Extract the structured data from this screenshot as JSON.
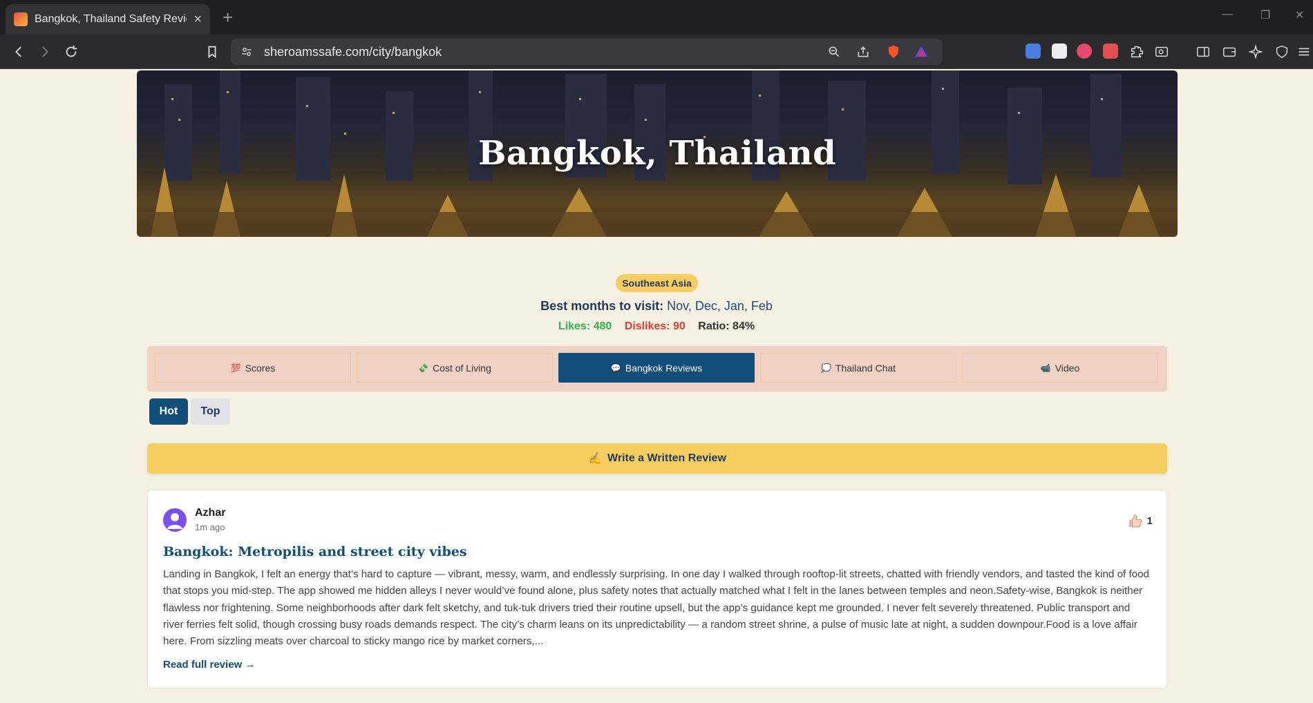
{
  "browser": {
    "tab_title": "Bangkok, Thailand Safety Review",
    "tab_close": "×",
    "new_tab": "+",
    "url": "sheroamssafe.com/city/bangkok"
  },
  "hero": {
    "title": "Bangkok, Thailand"
  },
  "info": {
    "region": "Southeast Asia",
    "best_months_label": "Best months to visit:",
    "best_months_value": "Nov, Dec, Jan, Feb",
    "likes": "Likes: 480",
    "dislikes": "Dislikes: 90",
    "ratio": "Ratio: 84%"
  },
  "tabs": [
    {
      "emoji": "💯",
      "label": "Scores"
    },
    {
      "emoji": "💸",
      "label": "Cost of Living"
    },
    {
      "emoji": "💬",
      "label": "Bangkok Reviews",
      "active": true
    },
    {
      "emoji": "💭",
      "label": "Thailand Chat"
    },
    {
      "emoji": "📹",
      "label": "Video"
    }
  ],
  "sort": {
    "hot": "Hot",
    "top": "Top"
  },
  "write": {
    "emoji": "✍️",
    "label": "Write a Written Review"
  },
  "review": {
    "author": "Azhar",
    "time": "1m ago",
    "likes": "1",
    "title": "Bangkok: Metropilis and street city vibes",
    "body": "Landing in Bangkok, I felt an energy that’s hard to capture — vibrant, messy, warm, and endlessly surprising. In one day I walked through rooftop-lit streets, chatted with friendly vendors, and tasted the kind of food that stops you mid-step. The app showed me hidden alleys I never would’ve found alone, plus safety notes that actually matched what I felt in the lanes between temples and neon.Safety-wise, Bangkok is neither flawless nor frightening. Some neighborhoods after dark felt sketchy, and tuk-tuk drivers tried their routine upsell, but the app’s guidance kept me grounded. I never felt severely threatened. Public transport and river ferries felt solid, though crossing busy roads demands respect. The city’s charm leans on its unpredictability — a random street shrine, a pulse of music late at night, a sudden downpour.Food is a love affair here. From sizzling meats over charcoal to sticky mango rice by market corners,...",
    "read_more": "Read full review →"
  },
  "colors": {
    "primary": "#114e7a",
    "accent": "#f8cd5f",
    "page_bg": "#f5f0e1",
    "likes": "#2fb34a",
    "dislikes": "#e23a3a"
  }
}
